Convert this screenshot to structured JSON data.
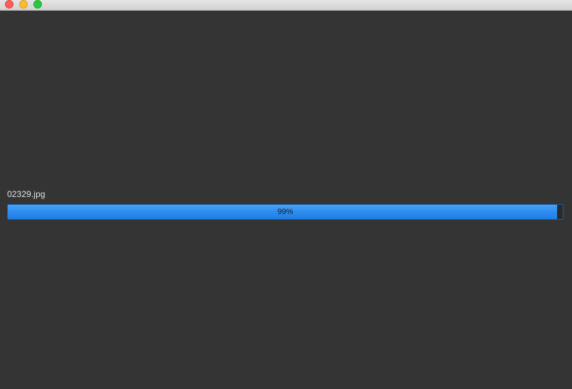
{
  "window": {
    "controls": [
      "close",
      "minimize",
      "zoom"
    ]
  },
  "file": {
    "name": "02329.jpg"
  },
  "progress": {
    "value": 0.99,
    "label": "99%",
    "color": "#2d8cf0"
  }
}
